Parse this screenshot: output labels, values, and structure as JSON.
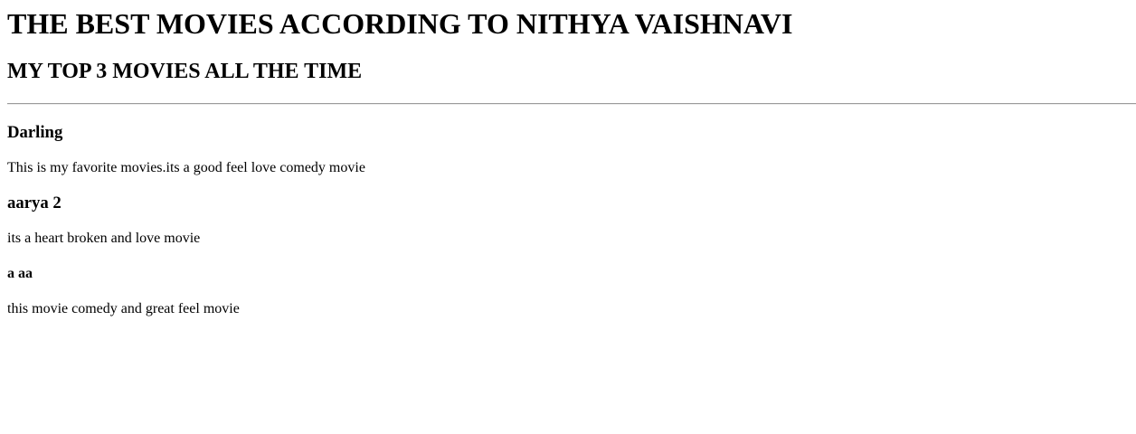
{
  "page": {
    "title": "THE BEST MOVIES ACCORDING TO NITHYA VAISHNAVI",
    "subtitle": "MY TOP 3 MOVIES ALL THE TIME"
  },
  "movies": [
    {
      "title": "Darling",
      "description": "This is my favorite movies.its a good feel love comedy movie"
    },
    {
      "title": "aarya 2",
      "description": "its a heart broken and love movie"
    },
    {
      "title": "a aa",
      "description": "this movie comedy and great feel movie"
    }
  ]
}
